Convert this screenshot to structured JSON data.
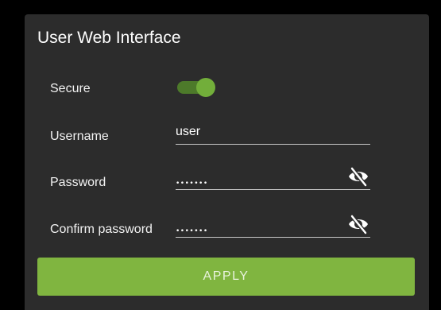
{
  "panel": {
    "title": "User Web Interface"
  },
  "secure": {
    "label": "Secure",
    "enabled": true
  },
  "username": {
    "label": "Username",
    "value": "user"
  },
  "password": {
    "label": "Password",
    "value": "•••••••"
  },
  "confirm_password": {
    "label": "Confirm password",
    "value": "•••••••"
  },
  "apply": {
    "label": "APPLY"
  },
  "icons": {
    "visibility_toggle": "eye-off-icon"
  },
  "colors": {
    "accent": "#80b540",
    "toggle_thumb": "#72ae3a",
    "panel_bg": "#2c2c2c"
  }
}
